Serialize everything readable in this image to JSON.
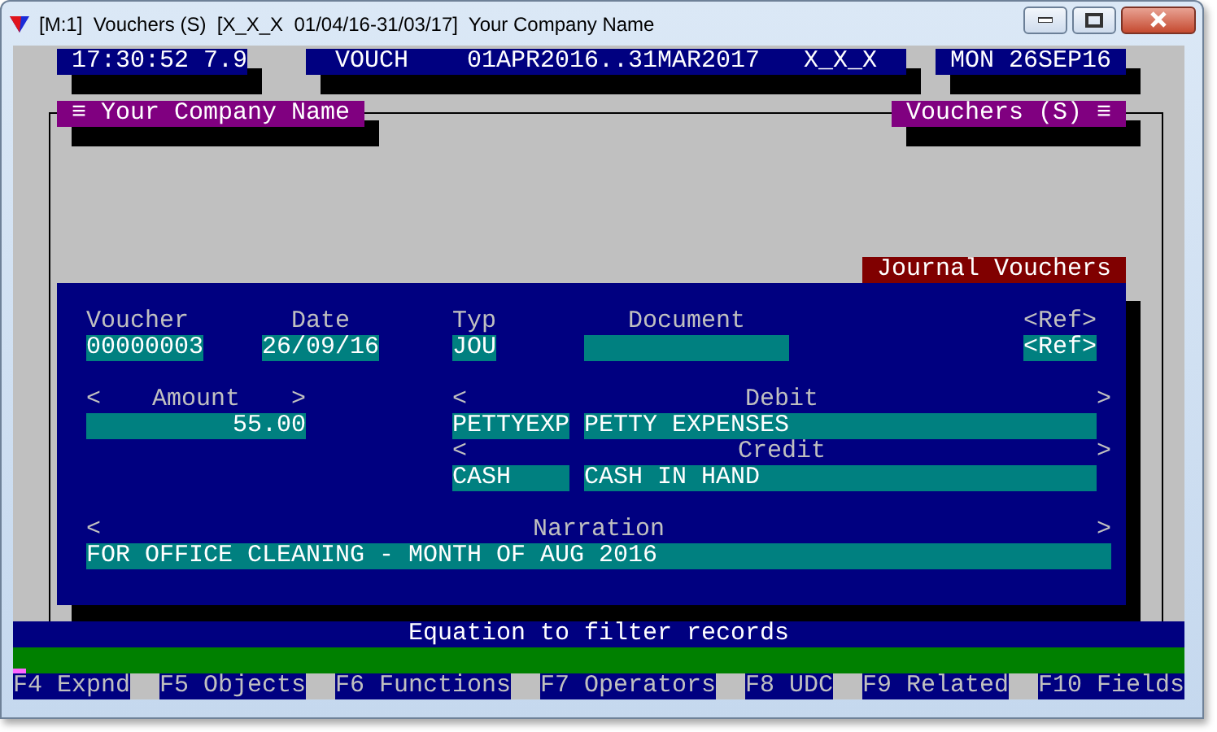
{
  "window": {
    "title": "[M:1]  Vouchers (S)  [X_X_X  01/04/16-31/03/17]  Your Company Name"
  },
  "header": {
    "clock": "17:30:52 7.9",
    "module": "VOUCH    01APR2016..31MAR2017   X_X_X",
    "date": "MON 26SEP16"
  },
  "frame": {
    "left_title": "≡ Your Company Name",
    "right_title": "Vouchers (S) ≡"
  },
  "form": {
    "title": "Journal Vouchers",
    "fields": [
      {
        "label": {
          "text": "Voucher"
        },
        "value": "00000003"
      },
      {
        "label": {
          "text": "Date"
        },
        "value": "26/09/16"
      },
      {
        "label": {
          "text": "Typ"
        },
        "value": "JOU"
      },
      {
        "label": {
          "text": "Document"
        }
      },
      {
        "label": {
          "text": "<Ref>"
        },
        "value": "<Ref>"
      },
      {
        "label": {
          "left": "<",
          "text": "Amount",
          "right": ">"
        },
        "value": "55.00"
      },
      {
        "label": {
          "left": "<",
          "text": "Debit",
          "right": ">"
        },
        "code": "PETTYEXP",
        "value": "PETTY EXPENSES"
      },
      {
        "label": {
          "left": "<",
          "text": "Credit",
          "right": ">"
        },
        "code": "CASH",
        "value": "CASH IN HAND"
      },
      {
        "label": {
          "left": "<",
          "text": "Narration",
          "right": ">"
        },
        "value": "FOR OFFICE CLEANING - MONTH OF AUG 2016"
      }
    ]
  },
  "filter": {
    "title": "Equation to filter records"
  },
  "function_keys": [
    "F4 Expnd",
    "F5 Objects",
    "F6 Functions",
    "F7 Operators",
    "F8 UDC",
    "F9 Related",
    "F10 Fields"
  ]
}
